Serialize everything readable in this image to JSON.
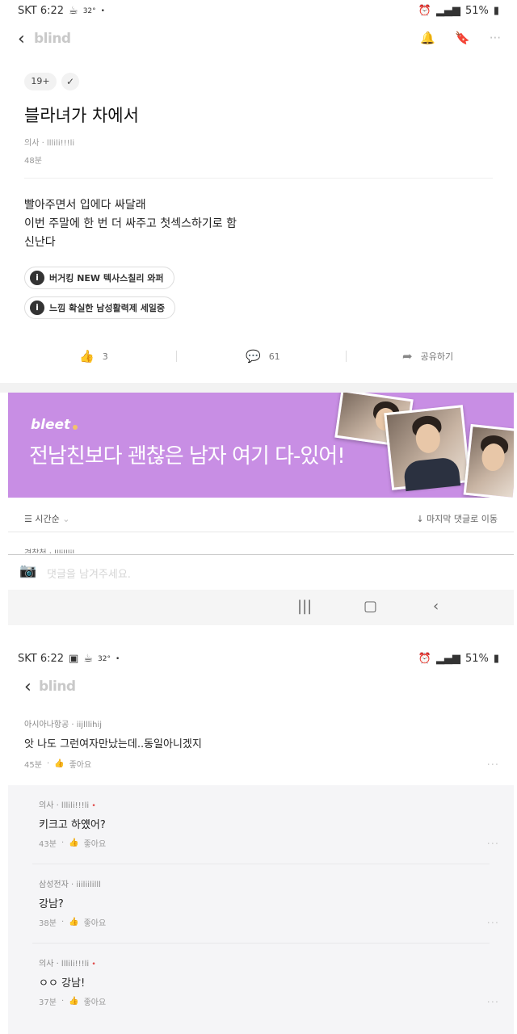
{
  "screen1": {
    "status": {
      "time": "SKT 6:22",
      "temp": "32°",
      "battery": "51%"
    },
    "nav": {
      "back": "‹",
      "logo": "blind"
    },
    "post": {
      "badge": "19+",
      "title": "블라녀가 차에서",
      "author": "의사 · lllili!!!li",
      "time": "48분",
      "body": [
        "빨아주면서 입에다 싸달래",
        "이번 주말에 한 번 더 싸주고 첫섹스하기로 함",
        "신난다"
      ],
      "promos": [
        "버거킹 NEW 텍사스칠리 와퍼",
        "느낌 확실한 남성활력제 세일중"
      ],
      "likes": "3",
      "comments": "61",
      "share": "공유하기"
    },
    "banner": {
      "brand": "bleet",
      "copy": "전남친보다 괜찮은 남자 여기 다-있어!"
    },
    "sort": {
      "left": "시간순",
      "right": "↓ 마지막 댓글로 이동"
    },
    "cutoff_name": "경찰청 · lllilllil",
    "input_placeholder": "댓글을 남겨주세요."
  },
  "screen2": {
    "status": {
      "time": "SKT 6:22",
      "temp": "32°",
      "battery": "51%"
    },
    "nav": {
      "back": "‹",
      "logo": "blind"
    },
    "comment": {
      "author": "아시아나항공 · iijlllihij",
      "text": "앗 나도 그런여자만났는데..동일아니겠지",
      "time": "45분",
      "like": "좋아요"
    },
    "replies": [
      {
        "author": "의사 · lllili!!!li",
        "op": "•",
        "text": "키크고 하얬어?",
        "time": "43분",
        "like": "좋아요"
      },
      {
        "author": "삼성전자 · iiiliililll",
        "op": "",
        "text": "강남?",
        "time": "38분",
        "like": "좋아요"
      },
      {
        "author": "의사 · lllili!!!li",
        "op": "•",
        "text": "ㅇㅇ 강남!",
        "time": "37분",
        "like": "좋아요"
      }
    ]
  },
  "colors": {
    "banner": "#c88ee4",
    "reply_bg": "#f5f5f7"
  }
}
